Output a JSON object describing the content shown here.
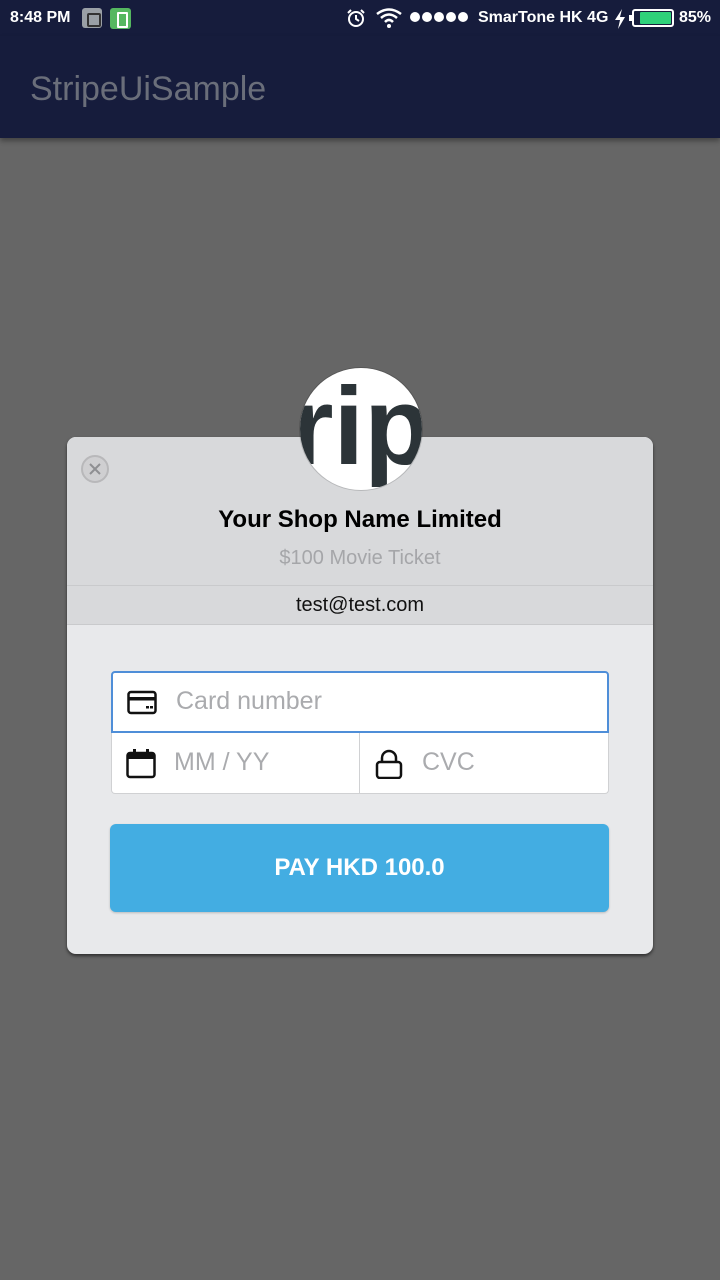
{
  "status_bar": {
    "time": "8:48 PM",
    "carrier": "SmarTone HK 4G",
    "battery": "85%",
    "battery_level": 0.85,
    "icons": [
      "screenshot-icon",
      "sim-icon",
      "alarm-icon",
      "wifi-icon",
      "signal-icon",
      "charging-icon",
      "battery-icon"
    ]
  },
  "app_bar": {
    "title": "StripeUiSample"
  },
  "dialog": {
    "shop_name": "Your Shop Name Limited",
    "description": "$100 Movie Ticket",
    "email": "test@test.com",
    "logo": {
      "text": "rip"
    },
    "card_number": {
      "placeholder": "Card number",
      "value": ""
    },
    "expiry": {
      "placeholder": "MM / YY",
      "value": ""
    },
    "cvc": {
      "placeholder": "CVC",
      "value": ""
    },
    "pay_button": "PAY HKD 100.0"
  },
  "colors": {
    "app_bar": "#161c3c",
    "scrim": "#666666",
    "accent": "#43ade2",
    "focus_border": "#4f8ed8"
  }
}
